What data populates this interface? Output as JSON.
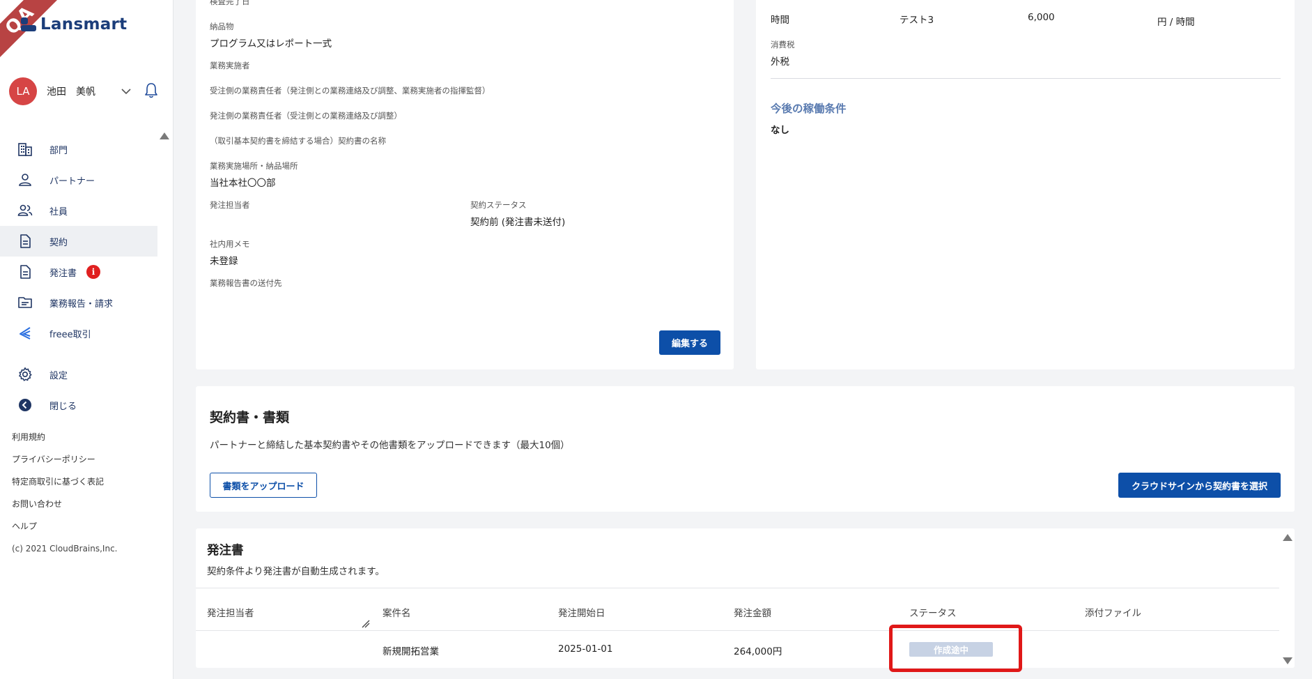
{
  "app": {
    "logo_text": "Lansmart",
    "ribbon_text": "QA"
  },
  "user": {
    "initials": "LA",
    "name": "池田　美帆"
  },
  "nav": {
    "items": [
      {
        "label": "部門",
        "icon": "building-icon"
      },
      {
        "label": "パートナー",
        "icon": "person-icon"
      },
      {
        "label": "社員",
        "icon": "people-icon"
      },
      {
        "label": "契約",
        "icon": "document-icon",
        "active": true
      },
      {
        "label": "発注書",
        "icon": "document-icon",
        "badge": "i"
      },
      {
        "label": "業務報告・請求",
        "icon": "folder-icon"
      },
      {
        "label": "freee取引",
        "icon": "freee-icon"
      }
    ],
    "settings_label": "設定",
    "close_label": "閉じる"
  },
  "footer": {
    "links": [
      "利用規約",
      "プライバシーポリシー",
      "特定商取引に基づく表記",
      "お問い合わせ",
      "ヘルプ"
    ],
    "copyright": "(c) 2021 CloudBrains,Inc."
  },
  "contract_detail": {
    "inspection_date_label": "検査完了日",
    "deliverable_label": "納品物",
    "deliverable_value": "プログラム又はレポート一式",
    "executor_label": "業務実施者",
    "contractor_manager_label": "受注側の業務責任者（発注側との業務連絡及び調整、業務実施者の指揮監督）",
    "orderer_manager_label": "発注側の業務責任者（受注側との業務連絡及び調整）",
    "basic_contract_label": "（取引基本契約書を締結する場合）契約書の名称",
    "location_label": "業務実施場所・納品場所",
    "location_value": "当社本社〇〇部",
    "order_person_label": "発注担当者",
    "contract_status_label": "契約ステータス",
    "contract_status_value": "契約前 (発注書未送付)",
    "memo_label": "社内用メモ",
    "memo_value": "未登録",
    "report_dest_label": "業務報告書の送付先",
    "edit_button": "編集する"
  },
  "rate": {
    "unit_type": "時間",
    "item": "テスト3",
    "price": "6,000",
    "unit": "円 / 時間",
    "tax_label": "消費税",
    "tax_value": "外税",
    "future_title": "今後の稼働条件",
    "future_value": "なし"
  },
  "documents": {
    "title": "契約書・書類",
    "description": "パートナーと締結した基本契約書やその他書類をアップロードできます（最大10個）",
    "upload_button": "書類をアップロード",
    "cloudsign_button": "クラウドサインから契約書を選択"
  },
  "purchase_orders": {
    "title": "発注書",
    "description": "契約条件より発注書が自動生成されます。",
    "columns": [
      "発注担当者",
      "案件名",
      "発注開始日",
      "発注金額",
      "ステータス",
      "添付ファイル"
    ],
    "rows": [
      {
        "person": "",
        "project": "新規開拓営業",
        "start_date": "2025-01-01",
        "amount": "264,000円",
        "status": "作成途中",
        "attachment": ""
      }
    ]
  },
  "colors": {
    "accent": "#0d4fa8",
    "nav_text": "#1f3563",
    "alert": "#e01818"
  }
}
